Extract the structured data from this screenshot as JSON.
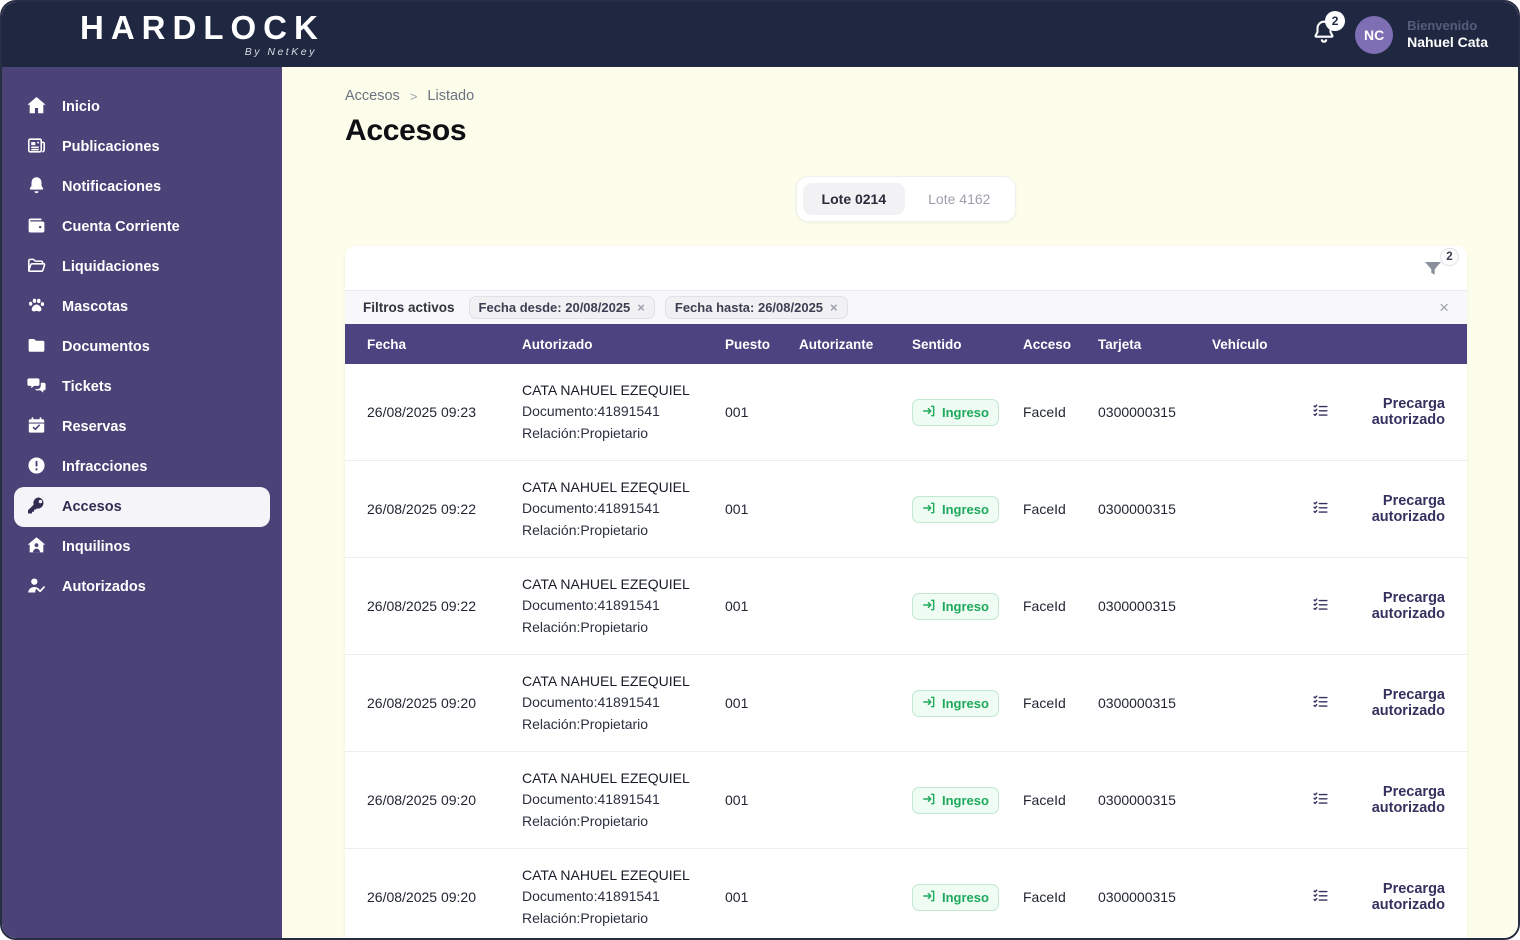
{
  "app": {
    "name": "HARDLOCK",
    "byline": "By NetKey"
  },
  "header": {
    "notification_count": "2",
    "avatar_initials": "NC",
    "welcome_label": "Bienvenido",
    "user_name": "Nahuel Cata"
  },
  "sidebar": {
    "items": [
      {
        "label": "Inicio",
        "icon": "home-icon",
        "active": false
      },
      {
        "label": "Publicaciones",
        "icon": "newspaper-icon",
        "active": false
      },
      {
        "label": "Notificaciones",
        "icon": "bell-icon",
        "active": false
      },
      {
        "label": "Cuenta Corriente",
        "icon": "wallet-icon",
        "active": false
      },
      {
        "label": "Liquidaciones",
        "icon": "folder-open-icon",
        "active": false
      },
      {
        "label": "Mascotas",
        "icon": "paw-icon",
        "active": false
      },
      {
        "label": "Documentos",
        "icon": "folder-icon",
        "active": false
      },
      {
        "label": "Tickets",
        "icon": "chat-icon",
        "active": false
      },
      {
        "label": "Reservas",
        "icon": "calendar-check-icon",
        "active": false
      },
      {
        "label": "Infracciones",
        "icon": "exclamation-circle-icon",
        "active": false
      },
      {
        "label": "Accesos",
        "icon": "key-icon",
        "active": true
      },
      {
        "label": "Inquilinos",
        "icon": "house-user-icon",
        "active": false
      },
      {
        "label": "Autorizados",
        "icon": "user-check-icon",
        "active": false
      }
    ]
  },
  "breadcrumb": {
    "root": "Accesos",
    "separator": ">",
    "current": "Listado"
  },
  "page": {
    "title": "Accesos"
  },
  "tabs": [
    {
      "label": "Lote 0214",
      "active": true
    },
    {
      "label": "Lote 4162",
      "active": false
    }
  ],
  "filter_bar": {
    "count_badge": "2",
    "active_label": "Filtros activos",
    "chips": [
      {
        "label": "Fecha desde: 20/08/2025",
        "close": "×"
      },
      {
        "label": "Fecha hasta: 26/08/2025",
        "close": "×"
      }
    ],
    "clear": "×"
  },
  "table": {
    "columns": [
      "Fecha",
      "Autorizado",
      "Puesto",
      "Autorizante",
      "Sentido",
      "Acceso",
      "Tarjeta",
      "Vehículo"
    ],
    "rows": [
      {
        "fecha": "26/08/2025 09:23",
        "autorizado_nombre": "CATA NAHUEL EZEQUIEL",
        "autorizado_documento": "Documento:41891541",
        "autorizado_relacion": "Relación:Propietario",
        "puesto": "001",
        "autorizante": "",
        "sentido": "Ingreso",
        "acceso": "FaceId",
        "tarjeta": "0300000315",
        "vehiculo": "",
        "accion": "Precarga autorizado"
      },
      {
        "fecha": "26/08/2025 09:22",
        "autorizado_nombre": "CATA NAHUEL EZEQUIEL",
        "autorizado_documento": "Documento:41891541",
        "autorizado_relacion": "Relación:Propietario",
        "puesto": "001",
        "autorizante": "",
        "sentido": "Ingreso",
        "acceso": "FaceId",
        "tarjeta": "0300000315",
        "vehiculo": "",
        "accion": "Precarga autorizado"
      },
      {
        "fecha": "26/08/2025 09:22",
        "autorizado_nombre": "CATA NAHUEL EZEQUIEL",
        "autorizado_documento": "Documento:41891541",
        "autorizado_relacion": "Relación:Propietario",
        "puesto": "001",
        "autorizante": "",
        "sentido": "Ingreso",
        "acceso": "FaceId",
        "tarjeta": "0300000315",
        "vehiculo": "",
        "accion": "Precarga autorizado"
      },
      {
        "fecha": "26/08/2025 09:20",
        "autorizado_nombre": "CATA NAHUEL EZEQUIEL",
        "autorizado_documento": "Documento:41891541",
        "autorizado_relacion": "Relación:Propietario",
        "puesto": "001",
        "autorizante": "",
        "sentido": "Ingreso",
        "acceso": "FaceId",
        "tarjeta": "0300000315",
        "vehiculo": "",
        "accion": "Precarga autorizado"
      },
      {
        "fecha": "26/08/2025 09:20",
        "autorizado_nombre": "CATA NAHUEL EZEQUIEL",
        "autorizado_documento": "Documento:41891541",
        "autorizado_relacion": "Relación:Propietario",
        "puesto": "001",
        "autorizante": "",
        "sentido": "Ingreso",
        "acceso": "FaceId",
        "tarjeta": "0300000315",
        "vehiculo": "",
        "accion": "Precarga autorizado"
      },
      {
        "fecha": "26/08/2025 09:20",
        "autorizado_nombre": "CATA NAHUEL EZEQUIEL",
        "autorizado_documento": "Documento:41891541",
        "autorizado_relacion": "Relación:Propietario",
        "puesto": "001",
        "autorizante": "",
        "sentido": "Ingreso",
        "acceso": "FaceId",
        "tarjeta": "0300000315",
        "vehiculo": "",
        "accion": "Precarga autorizado"
      }
    ]
  },
  "colors": {
    "header_bg": "#1f2840",
    "sidebar_bg": "#4b4277",
    "table_header_bg": "#4c4380",
    "main_bg": "#fdfdec",
    "accent_green": "#1fa95d",
    "avatar_bg": "#7e6fb5"
  }
}
